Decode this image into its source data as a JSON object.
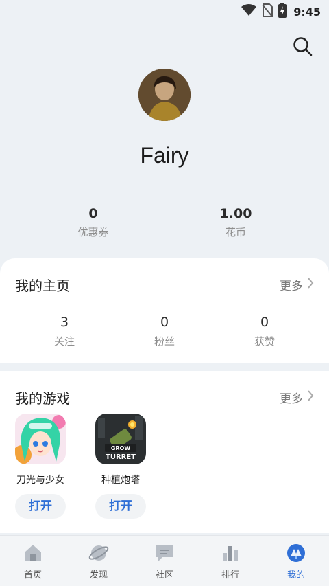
{
  "status_bar": {
    "time": "9:45"
  },
  "profile": {
    "username": "Fairy"
  },
  "wallet": [
    {
      "value": "0",
      "label": "优惠券"
    },
    {
      "value": "1.00",
      "label": "花币"
    }
  ],
  "home_card": {
    "title": "我的主页",
    "more_label": "更多",
    "stats": [
      {
        "value": "3",
        "label": "关注"
      },
      {
        "value": "0",
        "label": "粉丝"
      },
      {
        "value": "0",
        "label": "获赞"
      }
    ]
  },
  "games_card": {
    "title": "我的游戏",
    "more_label": "更多",
    "games": [
      {
        "name": "刀光与少女",
        "action": "打开"
      },
      {
        "name": "种植炮塔",
        "action": "打开",
        "icon_text_top": "GROW",
        "icon_text_bottom": "TURRET"
      }
    ]
  },
  "tabbar": {
    "tabs": [
      {
        "label": "首页",
        "icon": "home-icon"
      },
      {
        "label": "发现",
        "icon": "planet-icon"
      },
      {
        "label": "社区",
        "icon": "chat-icon"
      },
      {
        "label": "排行",
        "icon": "bar-chart-icon"
      },
      {
        "label": "我的",
        "icon": "profile-icon"
      }
    ],
    "active": "我的",
    "active_color": "#2f6fd6"
  }
}
